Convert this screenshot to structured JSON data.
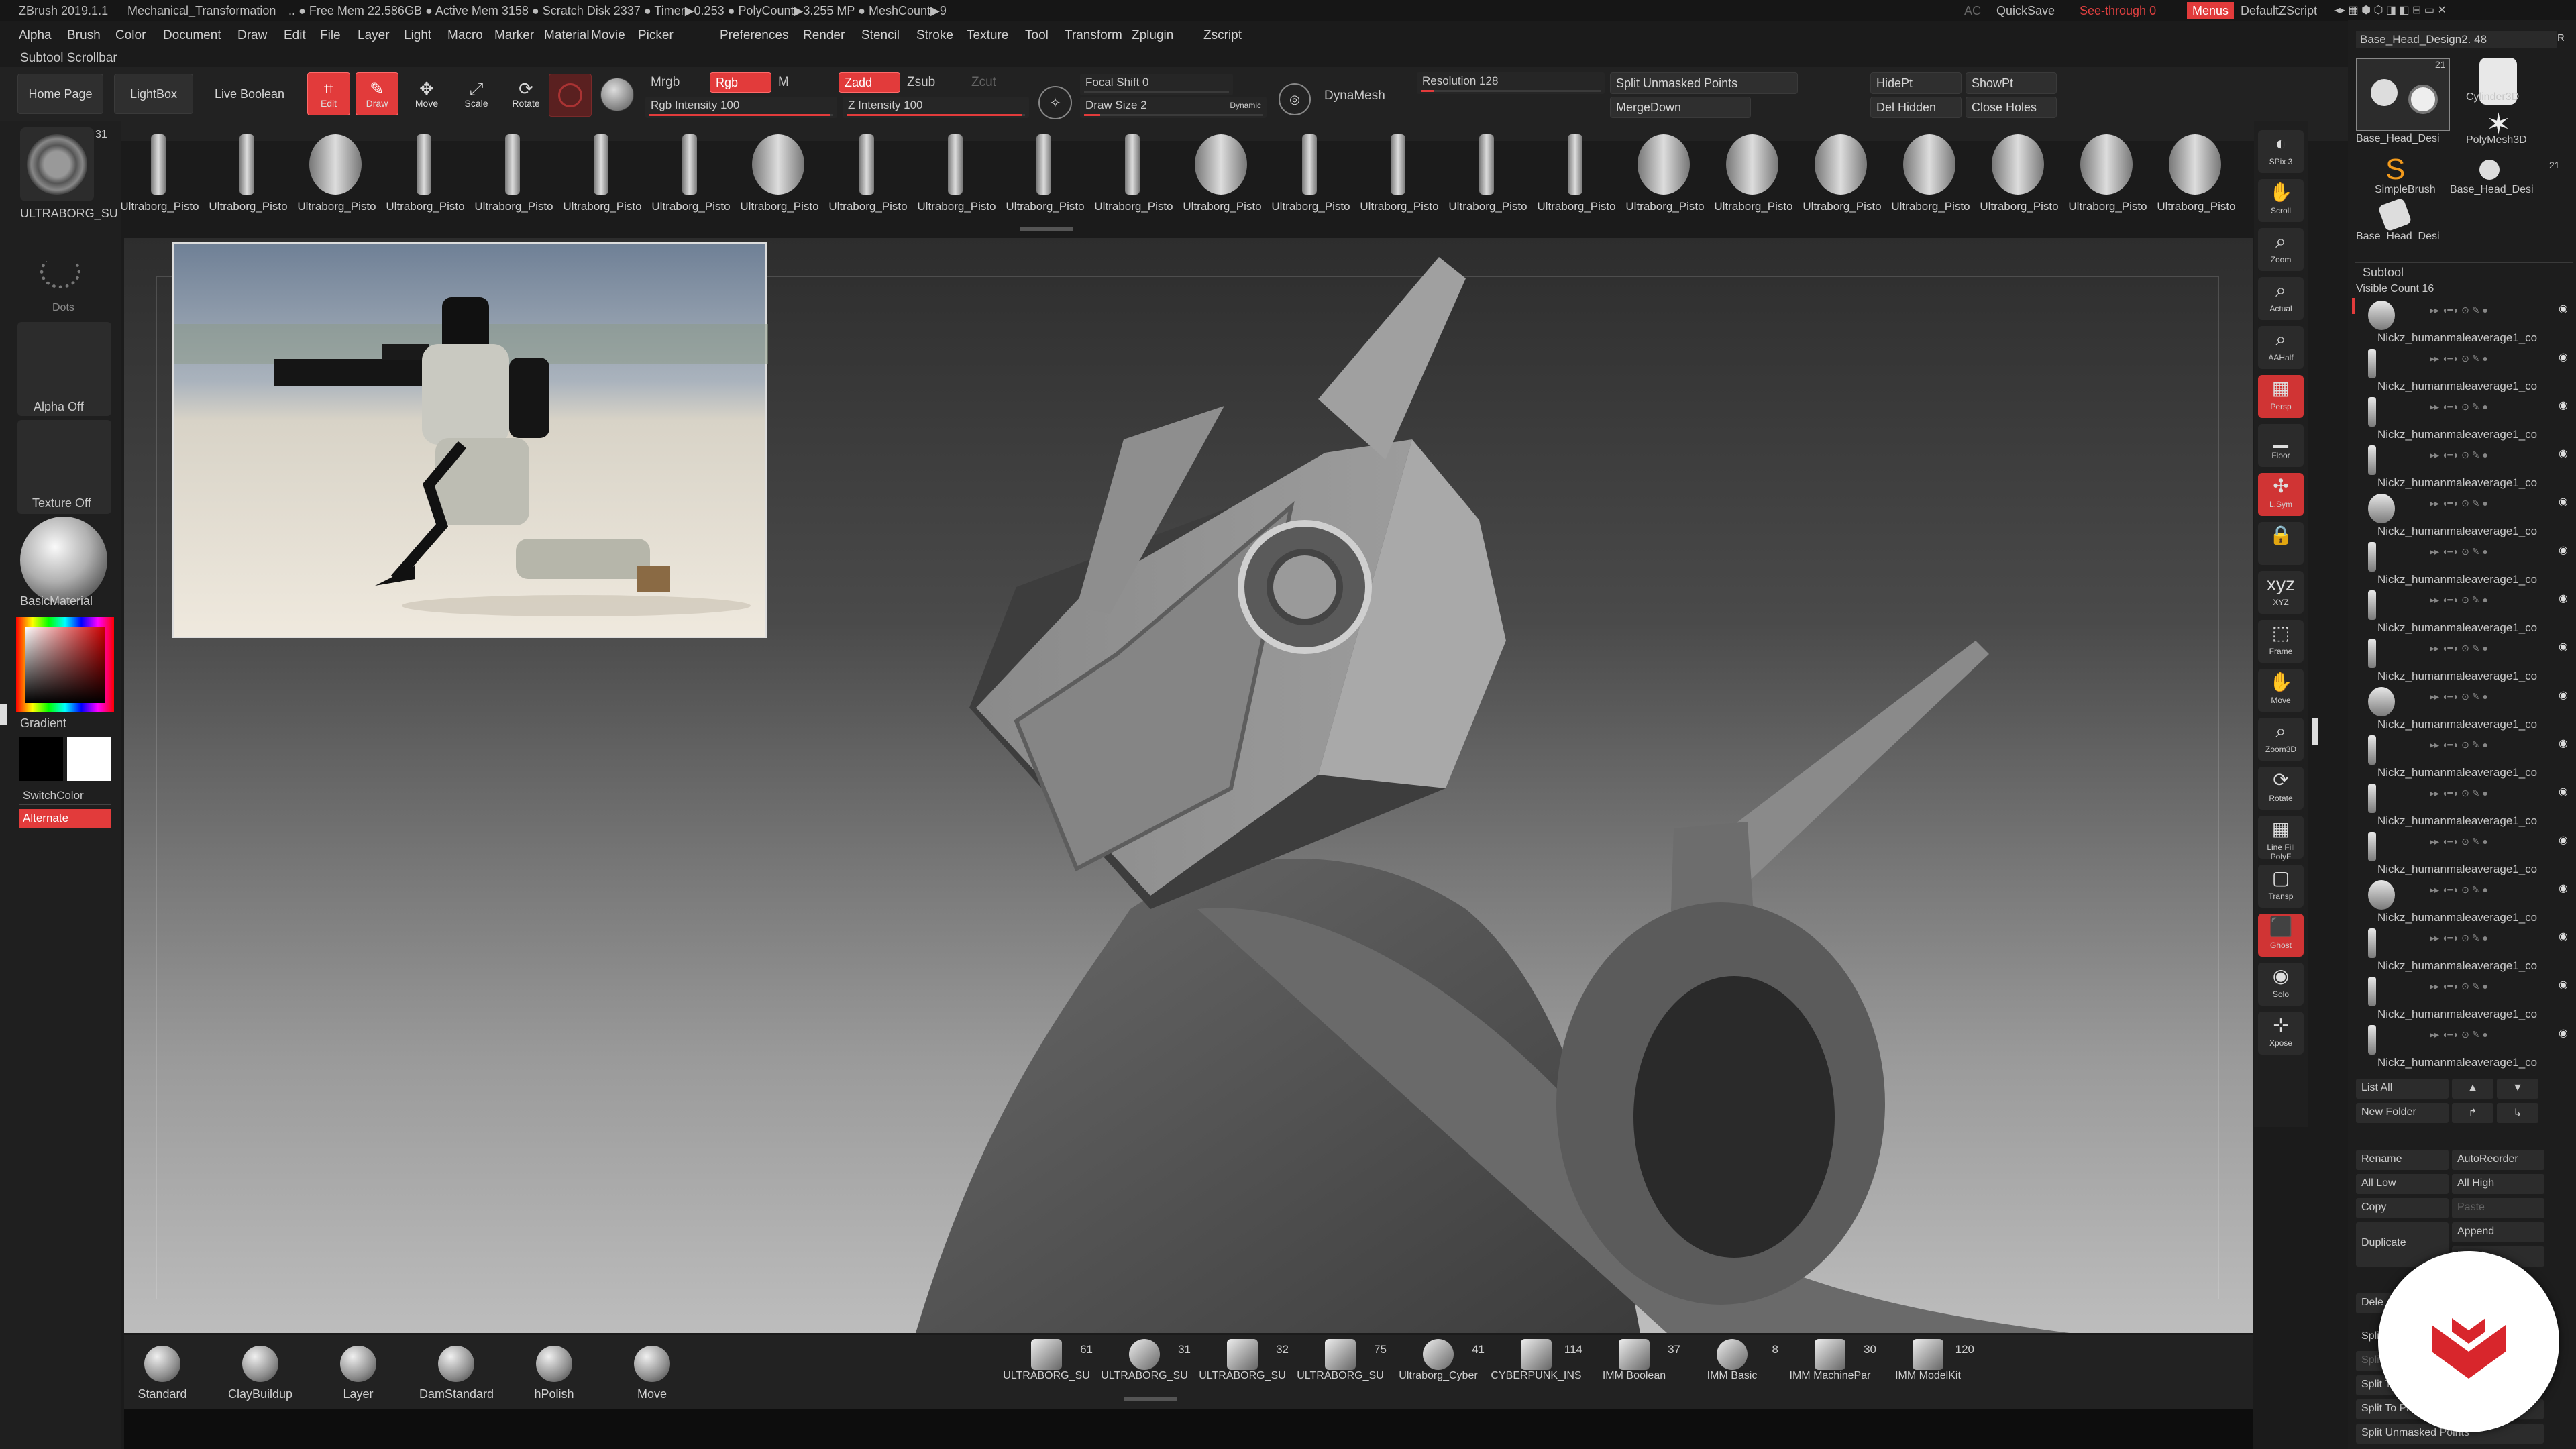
{
  "titlebar": {
    "app": "ZBrush 2019.1.1",
    "project": "Mechanical_Transformation",
    "stats": ".. ● Free Mem 22.586GB ● Active Mem 3158 ● Scratch Disk 2337 ● Timer▶0.253 ● PolyCount▶3.255 MP ● MeshCount▶9",
    "ac": "AC",
    "quicksave": "QuickSave",
    "see_through": "See-through  0",
    "menus": "Menus",
    "script": "DefaultZScript"
  },
  "menus": [
    "Alpha",
    "Brush",
    "Color",
    "Document",
    "Draw",
    "Edit",
    "File",
    "Layer",
    "Light",
    "Macro",
    "Marker",
    "Material",
    "Movie",
    "Picker",
    "Preferences",
    "Render",
    "Stencil",
    "Stroke",
    "Texture",
    "Tool",
    "Transform",
    "Zplugin",
    "Zscript"
  ],
  "subtool_scrollbar": "Subtool Scrollbar",
  "shelf": {
    "home_page": "Home Page",
    "lightbox": "LightBox",
    "live_boolean": "Live Boolean",
    "edit": "Edit",
    "draw": "Draw",
    "move": "Move",
    "scale": "Scale",
    "rotate": "Rotate",
    "mrgb": "Mrgb",
    "rgb": "Rgb",
    "m": "M",
    "rgb_intensity": "Rgb Intensity 100",
    "zadd": "Zadd",
    "zsub": "Zsub",
    "zcut": "Zcut",
    "z_intensity": "Z Intensity 100",
    "focal_shift": "Focal Shift 0",
    "draw_size": "Draw Size 2",
    "dynamic": "Dynamic",
    "dynamesh": "DynaMesh",
    "resolution": "Resolution 128",
    "split_unmasked": "Split Unmasked Points",
    "mergedown": "MergeDown",
    "hidept": "HidePt",
    "showpt": "ShowPt",
    "del_hidden": "Del Hidden",
    "close_holes": "Close Holes",
    "rgb_intensity_value": 100,
    "z_intensity_value": 100
  },
  "brush_strip_label": "Ultraborg_Pisto",
  "brush_strip_tail": "Ultraborg_Pisto Ultraborg_Pisto Ultraborg_Pisto Ultraborg_Pisto Ultraborg_Pisto Ultraborg_Pisto Ultraborg_Pisto Ultraborg_Pisto Ultraborg_Pisto Ultraborg_Pisto Ultraborg_Pisto Ultraborg_Pisto Ultraborg_Pisto Ultraborg_Pisto Ultraborg_Pisto Ultraborg_Pisto Ultraborg_Pisto Ultraborg_Pisto Ultraborg_Pisto Ultraborg_Pisto Ultraborg_Pisto Ultraborg_Pisto Ultraborg_Pisto Ultraborg_Pisto Ultraborg_Pi",
  "left": {
    "current_brush": "ULTRABORG_SU",
    "current_brush_count": "31",
    "dots": "Dots",
    "alpha": "Alpha Off",
    "texture": "Texture Off",
    "material": "BasicMaterial",
    "gradient": "Gradient",
    "switchcolor": "SwitchColor",
    "alternate": "Alternate"
  },
  "right_tools": [
    {
      "name": "spix",
      "label": "SPix 3"
    },
    {
      "name": "scroll",
      "label": "Scroll"
    },
    {
      "name": "zoom",
      "label": "Zoom"
    },
    {
      "name": "actual",
      "label": "Actual"
    },
    {
      "name": "aahalf",
      "label": "AAHalf"
    },
    {
      "name": "persp",
      "label": "Persp"
    },
    {
      "name": "floor",
      "label": "Floor"
    },
    {
      "name": "lsym",
      "label": "L.Sym"
    },
    {
      "name": "lock",
      "label": ""
    },
    {
      "name": "xyz",
      "label": "XYZ"
    },
    {
      "name": "frame",
      "label": "Frame"
    },
    {
      "name": "move",
      "label": "Move"
    },
    {
      "name": "zoom3d",
      "label": "Zoom3D"
    },
    {
      "name": "rotate",
      "label": "Rotate"
    },
    {
      "name": "polyf",
      "label": "Line Fill PolyF"
    },
    {
      "name": "transp",
      "label": "Transp"
    },
    {
      "name": "ghost",
      "label": "Ghost"
    },
    {
      "name": "solo",
      "label": "Solo"
    },
    {
      "name": "xpose",
      "label": "Xpose"
    }
  ],
  "right_panel": {
    "tool_name": "Base_Head_Design2. 48",
    "tool_r": "R",
    "tool_count": "21",
    "tool_count2": "21",
    "thumbs": [
      "Base_Head_Desi",
      "Cylinder3D",
      "PolyMesh3D",
      "SimpleBrush",
      "Base_Head_Desi",
      "Base_Head_Desi"
    ],
    "subtool": "Subtool",
    "visible_count": "Visible Count 16",
    "subtools": [
      "Nickz_humanmaleaverage1_co",
      "Nickz_humanmaleaverage1_co",
      "Nickz_humanmaleaverage1_co",
      "Nickz_humanmaleaverage1_co",
      "Nickz_humanmaleaverage1_co",
      "Nickz_humanmaleaverage1_co",
      "Nickz_humanmaleaverage1_co",
      "Nickz_humanmaleaverage1_co",
      "Nickz_humanmaleaverage1_co",
      "Nickz_humanmaleaverage1_co",
      "Nickz_humanmaleaverage1_co",
      "Nickz_humanmaleaverage1_co",
      "Nickz_humanmaleaverage1_co",
      "Nickz_humanmaleaverage1_co",
      "Nickz_humanmaleaverage1_co",
      "Nickz_humanmaleaverage1_co"
    ],
    "list_all": "List All",
    "new_folder": "New Folder",
    "rename": "Rename",
    "autoreorder": "AutoReorder",
    "all_low": "All Low",
    "all_high": "All High",
    "copy": "Copy",
    "paste": "Paste",
    "duplicate": "Duplicate",
    "append": "Append",
    "insert": "Insert",
    "delete": "Dele",
    "split": "Split",
    "split_to": "Split To",
    "split_to_parts": "Split To Parts",
    "split_unmasked": "Split Unmasked Points",
    "split_s": "Split S",
    "split_r": "plit"
  },
  "bottom_brushes": [
    "Standard",
    "ClayBuildup",
    "Layer",
    "DamStandard",
    "hPolish",
    "Move"
  ],
  "quick_brushes": [
    {
      "name": "ULTRABORG_SU",
      "count": "61"
    },
    {
      "name": "ULTRABORG_SU",
      "count": "31"
    },
    {
      "name": "ULTRABORG_SU",
      "count": "32"
    },
    {
      "name": "ULTRABORG_SU",
      "count": "75"
    },
    {
      "name": "Ultraborg_Cyber",
      "count": "41"
    },
    {
      "name": "CYBERPUNK_INS",
      "count": "114"
    },
    {
      "name": "IMM Boolean",
      "count": "37"
    },
    {
      "name": "IMM Basic",
      "count": "8"
    },
    {
      "name": "IMM MachinePar",
      "count": "30"
    },
    {
      "name": "IMM ModelKit",
      "count": "120"
    }
  ],
  "colors": {
    "accent": "#e23b3b",
    "panel": "#1d1d1d",
    "canvas_top": "#2d2d2d",
    "canvas_bottom": "#bdbdbd"
  }
}
